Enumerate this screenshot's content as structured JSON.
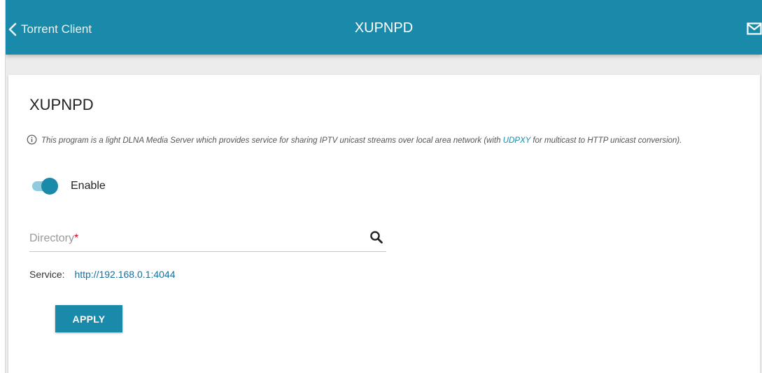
{
  "header": {
    "back_label": "Torrent Client",
    "title": "XUPNPD",
    "back_icon": "chevron-left-icon",
    "mail_icon": "envelope-icon"
  },
  "main": {
    "title": "XUPNPD",
    "info": {
      "icon": "info-circle-icon",
      "text_before": "This program is a light DLNA Media Server which provides service for sharing IPTV unicast streams over local area network (with ",
      "link": "UDPXY",
      "text_after": " for multicast to HTTP unicast conversion)."
    },
    "enable": {
      "label": "Enable",
      "checked": true
    },
    "directory": {
      "label": "Directory",
      "required_mark": "*",
      "icon": "search-icon"
    },
    "service": {
      "label": "Service:",
      "url": "http://192.168.0.1:4044"
    },
    "apply_label": "APPLY"
  },
  "colors": {
    "accent": "#1a8aaa",
    "toggle_track": "#8ecbdd",
    "link": "#1a6f9a",
    "required": "#d0021b",
    "background": "#ececec"
  }
}
